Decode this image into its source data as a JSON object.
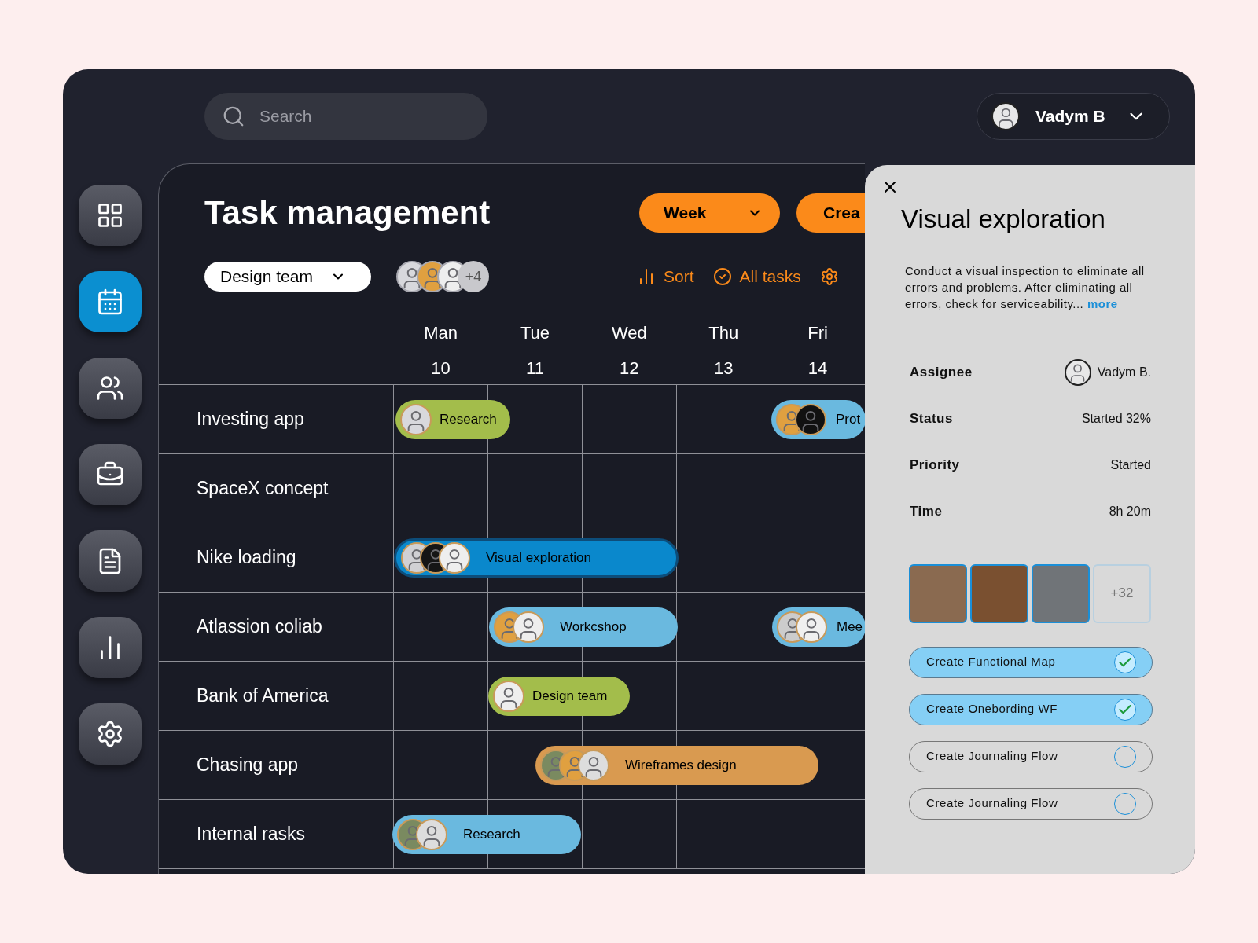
{
  "search": {
    "placeholder": "Search"
  },
  "user": {
    "name": "Vadym B"
  },
  "sidebar": {
    "items": [
      {
        "selected": false
      },
      {
        "selected": true
      },
      {
        "selected": false
      },
      {
        "selected": false
      },
      {
        "selected": false
      },
      {
        "selected": false
      },
      {
        "selected": false
      }
    ]
  },
  "header": {
    "title": "Task management",
    "view_button": "Week",
    "create_button": "Crea"
  },
  "toolbar": {
    "team": "Design team",
    "extra_members": "+4",
    "actions": [
      {
        "label": "Sort"
      },
      {
        "label": "All tasks"
      }
    ]
  },
  "days": [
    {
      "name": "Man",
      "date": "10"
    },
    {
      "name": "Tue",
      "date": "11"
    },
    {
      "name": "Wed",
      "date": "12"
    },
    {
      "name": "Thu",
      "date": "13"
    },
    {
      "name": "Fri",
      "date": "14"
    }
  ],
  "rows": [
    {
      "project": "Investing app",
      "tasks": [
        {
          "label": "Research",
          "color": "#a3bd4b"
        },
        {
          "label": "Prot",
          "color": "#6ab9df"
        }
      ]
    },
    {
      "project": "SpaceX concept",
      "tasks": []
    },
    {
      "project": "Nike loading",
      "tasks": [
        {
          "label": "Visual exploration",
          "color": "#0a88cc",
          "selected": true
        }
      ]
    },
    {
      "project": "Atlassion coliab",
      "tasks": [
        {
          "label": "Workcshop",
          "color": "#6ab9df"
        },
        {
          "label": "Mee",
          "color": "#6ab9df"
        }
      ]
    },
    {
      "project": "Bank of America",
      "tasks": [
        {
          "label": "Design team",
          "color": "#a3bd4b"
        }
      ]
    },
    {
      "project": "Chasing app",
      "tasks": [
        {
          "label": "Wireframes design",
          "color": "#d99a50"
        }
      ]
    },
    {
      "project": "Internal rasks",
      "tasks": [
        {
          "label": "Research",
          "color": "#6ab9df"
        }
      ]
    }
  ],
  "detail": {
    "title": "Visual exploration",
    "description": "Conduct a visual inspection to eliminate all errors and problems. After eliminating all errors, check for serviceability...",
    "more_link": "more",
    "fields": [
      {
        "label": "Assignee",
        "value": "Vadym B.",
        "kind": "person"
      },
      {
        "label": "Status",
        "value": "Started 32%",
        "kind": "text"
      },
      {
        "label": "Priority",
        "value": "Started",
        "kind": "text"
      },
      {
        "label": "Time",
        "value": "8h 20m",
        "kind": "text"
      }
    ],
    "attachments_more": "+32",
    "checklist": [
      {
        "label": "Create Functional Map",
        "checked": true
      },
      {
        "label": "Create Onebording WF",
        "checked": true
      },
      {
        "label": "Create Journaling Flow",
        "checked": false
      },
      {
        "label": "Create Journaling Flow",
        "checked": false
      }
    ]
  }
}
